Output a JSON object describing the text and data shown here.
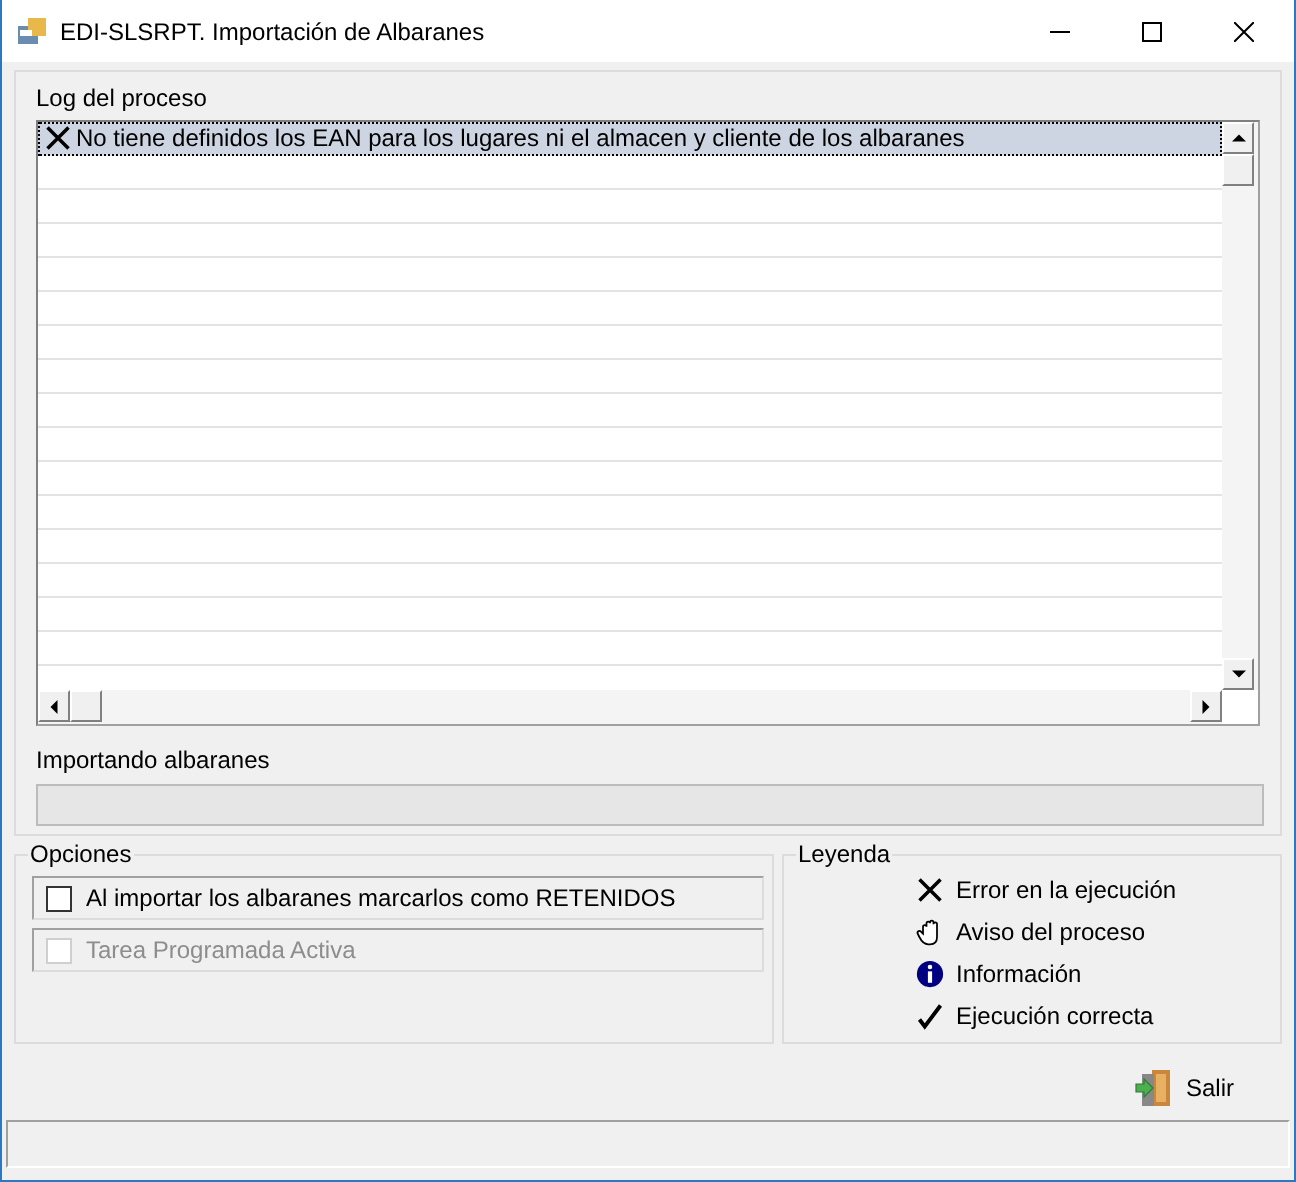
{
  "window": {
    "title": "EDI-SLSRPT. Importación de Albaranes"
  },
  "log": {
    "label": "Log del proceso",
    "entries": [
      {
        "kind": "error",
        "text": "No tiene definidos los EAN para los lugares ni el almacen y cliente de los albaranes",
        "selected": true
      }
    ]
  },
  "progress": {
    "label": "Importando albaranes",
    "level": 0
  },
  "options": {
    "title": "Opciones",
    "items": [
      {
        "label": "Al importar los albaranes marcarlos como RETENIDOS",
        "checked": false,
        "disabled": false
      },
      {
        "label": "Tarea Programada Activa",
        "checked": false,
        "disabled": true
      }
    ]
  },
  "legend": {
    "title": "Leyenda",
    "items": [
      {
        "kind": "error",
        "label": "Error en la ejecución"
      },
      {
        "kind": "warning",
        "label": "Aviso del proceso"
      },
      {
        "kind": "info",
        "label": "Información"
      },
      {
        "kind": "ok",
        "label": "Ejecución correcta"
      }
    ]
  },
  "buttons": [
    {
      "label": "Salir"
    }
  ]
}
